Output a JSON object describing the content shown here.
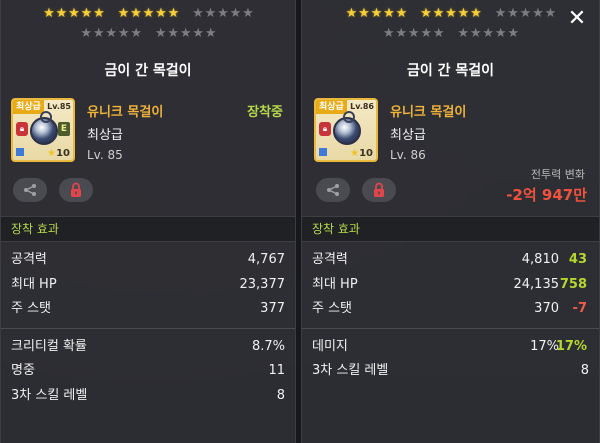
{
  "left": {
    "stars_row1": [
      "gold",
      "gold",
      "gold",
      "gold",
      "gold",
      "gold",
      "gold",
      "gold",
      "gold",
      "gold",
      "gray",
      "gray",
      "gray",
      "gray",
      "gray"
    ],
    "stars_row2": [
      "gray",
      "gray",
      "gray",
      "gray",
      "gray",
      "gray",
      "gray",
      "gray",
      "gray",
      "gray"
    ],
    "title": "금이 간 목걸이",
    "grade_tag": "최상급",
    "lv_tag": "Lv.85",
    "item_name": "유니크 목걸이",
    "equipped": "장착중",
    "grade_text": "최상급",
    "level_text": "Lv. 85",
    "star_count": "10",
    "equip_badge": "E",
    "section_title": "장착 효과",
    "stats_a": [
      {
        "label": "공격력",
        "value": "4,767"
      },
      {
        "label": "최대 HP",
        "value": "23,377"
      },
      {
        "label": "주 스탯",
        "value": "377"
      }
    ],
    "stats_b": [
      {
        "label": "크리티컬 확률",
        "value": "8.7%"
      },
      {
        "label": "명중",
        "value": "11"
      },
      {
        "label": "3차 스킬 레벨",
        "value": "8"
      }
    ]
  },
  "right": {
    "stars_row1": [
      "gold",
      "gold",
      "gold",
      "gold",
      "gold",
      "gold",
      "gold",
      "gold",
      "gold",
      "gold",
      "gray",
      "gray",
      "gray",
      "gray",
      "gray"
    ],
    "stars_row2": [
      "gray",
      "gray",
      "gray",
      "gray",
      "gray",
      "gray",
      "gray",
      "gray",
      "gray",
      "gray"
    ],
    "title": "금이 간 목걸이",
    "close_label": "✕",
    "grade_tag": "최상급",
    "lv_tag": "Lv.86",
    "item_name": "유니크 목걸이",
    "grade_text": "최상급",
    "level_text": "Lv. 86",
    "star_count": "10",
    "power_label": "전투력 변화",
    "power_value": "-2억 947만",
    "section_title": "장착 효과",
    "stats_a": [
      {
        "label": "공격력",
        "value": "4,810",
        "delta": "43",
        "dir": "up"
      },
      {
        "label": "최대 HP",
        "value": "24,135",
        "delta": "758",
        "dir": "up"
      },
      {
        "label": "주 스탯",
        "value": "370",
        "delta": "-7",
        "dir": "down"
      }
    ],
    "stats_b": [
      {
        "label": "데미지",
        "value": "17%",
        "delta": "17%",
        "dir": "up"
      },
      {
        "label": "3차 스킬 레벨",
        "value": "8"
      }
    ]
  },
  "colors": {
    "gold_text": "#f0b33a",
    "green_text": "#b5d84b",
    "red_text": "#f0523e",
    "panel_bg": "#2e2f34"
  },
  "icons": {
    "share": "share-icon",
    "lock": "lock-icon",
    "close": "close-icon",
    "star": "star-icon"
  }
}
